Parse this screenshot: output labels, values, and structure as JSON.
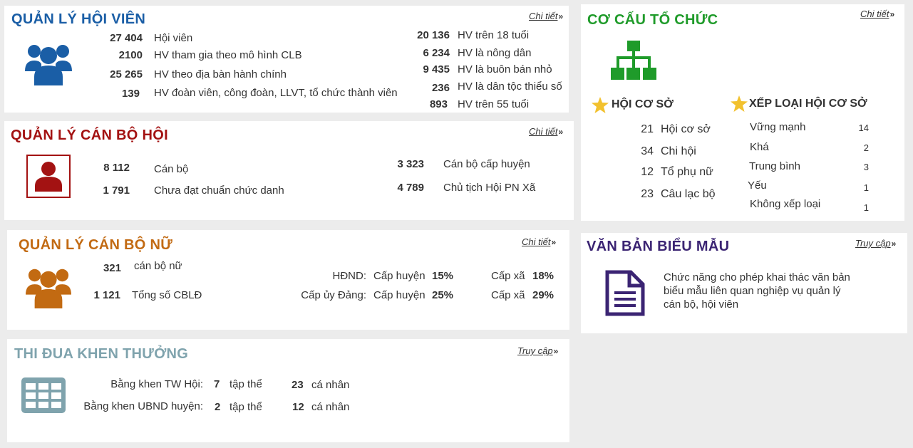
{
  "members": {
    "title": "QUẢN LÝ HỘI VIÊN",
    "link": "Chi tiết",
    "left": [
      {
        "value": "27 404",
        "label": "Hội viên"
      },
      {
        "value": "2100",
        "label": "HV tham gia theo mô hình CLB"
      },
      {
        "value": "25 265",
        "label": "HV theo địa bàn hành chính"
      },
      {
        "value": "139",
        "label": "HV đoàn viên, công đoàn, LLVT, tổ chức thành viên"
      }
    ],
    "right": [
      {
        "value": "20 136",
        "label": "HV trên 18 tuổi"
      },
      {
        "value": "6 234",
        "label": "HV là nông dân"
      },
      {
        "value": "9 435",
        "label": "HV là buôn bán nhỏ"
      },
      {
        "value": "236",
        "label": "HV là dân tộc thiểu số"
      },
      {
        "value": "893",
        "label": "HV trên 55 tuổi"
      }
    ],
    "icon": "users-icon",
    "color": "#1a5ea6"
  },
  "staff": {
    "title": "QUẢN LÝ CÁN BỘ HỘI",
    "link": "Chi tiết",
    "left": [
      {
        "value": "8 112",
        "label": "Cán bộ"
      },
      {
        "value": "1 791",
        "label": "Chưa đạt chuẩn chức danh"
      }
    ],
    "right": [
      {
        "value": "3 323",
        "label": "Cán bộ cấp huyện"
      },
      {
        "value": "4 789",
        "label": "Chủ tịch Hội PN Xã"
      }
    ],
    "icon": "user-icon",
    "color": "#a31212"
  },
  "women": {
    "title": "QUẢN LÝ CÁN BỘ NỮ",
    "link": "Chi tiết",
    "left": [
      {
        "value": "321",
        "label": "cán bộ nữ"
      },
      {
        "value": "1 121",
        "label": "Tổng số CBLĐ"
      }
    ],
    "rows": [
      {
        "label": "HĐND:",
        "level1": "Cấp huyện",
        "pct1": "15%",
        "level2": "Cấp xã",
        "pct2": "18%"
      },
      {
        "label": "Cấp ủy Đảng:",
        "level1": "Cấp huyện",
        "pct1": "25%",
        "level2": "Cấp xã",
        "pct2": "29%"
      }
    ],
    "icon": "users-icon",
    "color": "#c26a12"
  },
  "awards": {
    "title": "THI ĐUA KHEN THƯỞNG",
    "link": "Truy cập",
    "rows": [
      {
        "label": "Bằng khen TW Hội:",
        "n1": "7",
        "u1": "tập thể",
        "n2": "23",
        "u2": "cá nhân"
      },
      {
        "label": "Bằng khen UBND huyện:",
        "n1": "2",
        "u1": "tập thể",
        "n2": "12",
        "u2": "cá nhân"
      }
    ],
    "icon": "table-icon",
    "color": "#7fa3ad"
  },
  "org": {
    "title": "CƠ CẤU TỔ CHỨC",
    "link": "Chi tiết",
    "icon": "org-chart-icon",
    "color": "#1f9b2a",
    "base_title": "HỘI CƠ SỞ",
    "base": [
      {
        "value": "21",
        "label": "Hội cơ sở"
      },
      {
        "value": "34",
        "label": "Chi hội"
      },
      {
        "value": "12",
        "label": "Tổ phụ nữ"
      },
      {
        "value": "23",
        "label": "Câu lạc bộ"
      }
    ],
    "rank_title": "XẾP LOẠI HỘI CƠ SỞ",
    "ranks": [
      {
        "label": "Vững mạnh",
        "value": "14"
      },
      {
        "label": "Khá",
        "value": "2"
      },
      {
        "label": "Trung bình",
        "value": "3"
      },
      {
        "label": "Yếu",
        "value": "1"
      },
      {
        "label": "Không xếp loại",
        "value": "1"
      }
    ],
    "star_color": "#f2c12e"
  },
  "docs": {
    "title": "VĂN BẢN BIỂU MẪU",
    "link": "Truy cập",
    "desc_lines": [
      "Chức năng cho phép khai thác văn bản",
      "biểu mẫu liên quan nghiệp vụ quản lý",
      "cán bộ, hội viên"
    ],
    "icon": "document-icon",
    "color": "#3b2473"
  }
}
